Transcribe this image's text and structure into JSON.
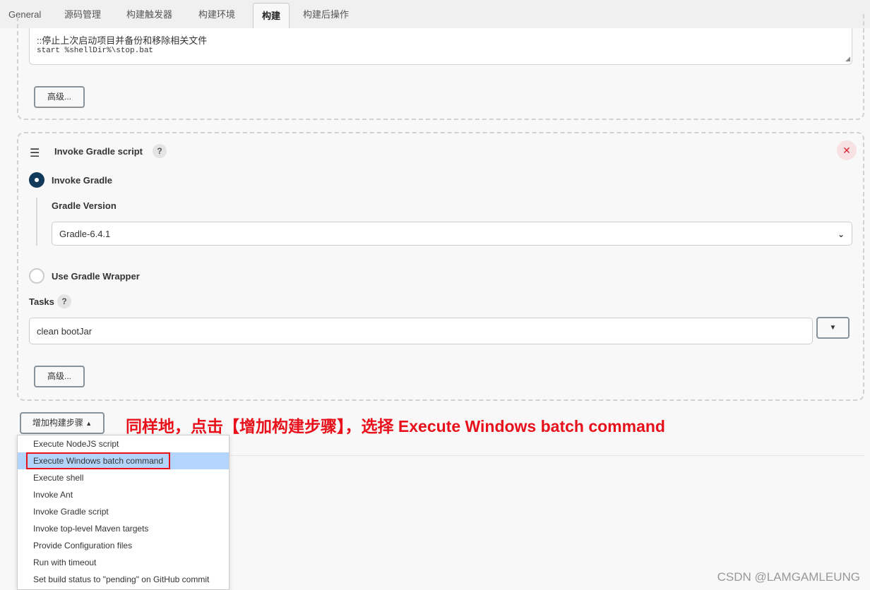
{
  "tabs": [
    "General",
    "源码管理",
    "构建触发器",
    "构建环境",
    "构建",
    "构建后操作"
  ],
  "active_tab": "构建",
  "prev_step": {
    "script_line1": "::停止上次启动项目并备份和移除相关文件",
    "script_line2": "start %shellDir%\\stop.bat",
    "advanced": "高级..."
  },
  "gradle_step": {
    "title": "Invoke Gradle script",
    "help": "?",
    "invoke_gradle": "Invoke Gradle",
    "gradle_version_label": "Gradle Version",
    "gradle_version": "Gradle-6.4.1",
    "use_wrapper": "Use Gradle Wrapper",
    "tasks_label": "Tasks",
    "tasks_value": "clean bootJar",
    "advanced": "高级...",
    "selected_option": "Invoke Gradle"
  },
  "add_step": {
    "label": "增加构建步骤",
    "menu": [
      "Execute NodeJS script",
      "Execute Windows batch command",
      "Execute shell",
      "Invoke Ant",
      "Invoke Gradle script",
      "Invoke top-level Maven targets",
      "Provide Configuration files",
      "Run with timeout",
      "Set build status to \"pending\" on GitHub commit"
    ],
    "highlighted": "Execute Windows batch command"
  },
  "annotation": "同样地，点击【增加构建步骤】，选择 Execute Windows batch command",
  "watermark": "CSDN @LAMGAMLEUNG",
  "colors": {
    "annotation": "#e8101a",
    "highlight": "#b3d4fc",
    "radio_selected": "#123a5a",
    "delete": "#e0202a"
  }
}
